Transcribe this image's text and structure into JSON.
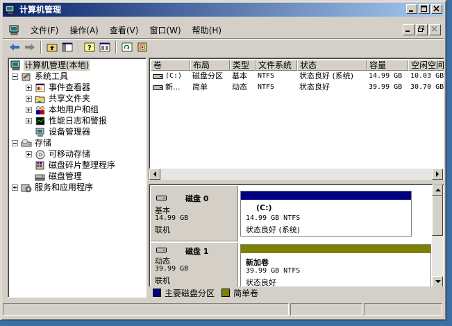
{
  "window": {
    "title": "计算机管理",
    "title_gradient": [
      "#0a246a",
      "#a6caf0"
    ]
  },
  "menu": [
    "文件(F)",
    "操作(A)",
    "查看(V)",
    "窗口(W)",
    "帮助(H)"
  ],
  "tree": {
    "root": "计算机管理(本地)",
    "system_tools": "系统工具",
    "event_viewer": "事件查看器",
    "shared_folders": "共享文件夹",
    "local_users": "本地用户和组",
    "perf_logs": "性能日志和警报",
    "device_manager": "设备管理器",
    "storage": "存储",
    "removable": "可移动存储",
    "defrag": "磁盘碎片整理程序",
    "disk_mgmt": "磁盘管理",
    "services": "服务和应用程序"
  },
  "volumes": {
    "columns": [
      "卷",
      "布局",
      "类型",
      "文件系统",
      "状态",
      "容量",
      "空闲空间"
    ],
    "rows": [
      [
        "(C:)",
        "磁盘分区",
        "基本",
        "NTFS",
        "状态良好 (系统)",
        "14.99 GB",
        "10.03 GB"
      ],
      [
        "新...",
        "简单",
        "动态",
        "NTFS",
        "状态良好",
        "39.99 GB",
        "30.70 GB"
      ]
    ]
  },
  "disks": [
    {
      "name": "磁盘 0",
      "type": "基本",
      "size": "14.99 GB",
      "status": "联机",
      "partition": {
        "label": "(C:)",
        "info": "14.99 GB NTFS",
        "status": "状态良好 (系统)",
        "color": "#000080"
      }
    },
    {
      "name": "磁盘 1",
      "type": "动态",
      "size": "39.99 GB",
      "status": "联机",
      "partition": {
        "label": "新加卷",
        "info": "39.99 GB NTFS",
        "status": "状态良好",
        "color": "#808000"
      }
    }
  ],
  "legend": [
    {
      "label": "主要磁盘分区",
      "color": "#000080"
    },
    {
      "label": "简单卷",
      "color": "#808000"
    }
  ]
}
